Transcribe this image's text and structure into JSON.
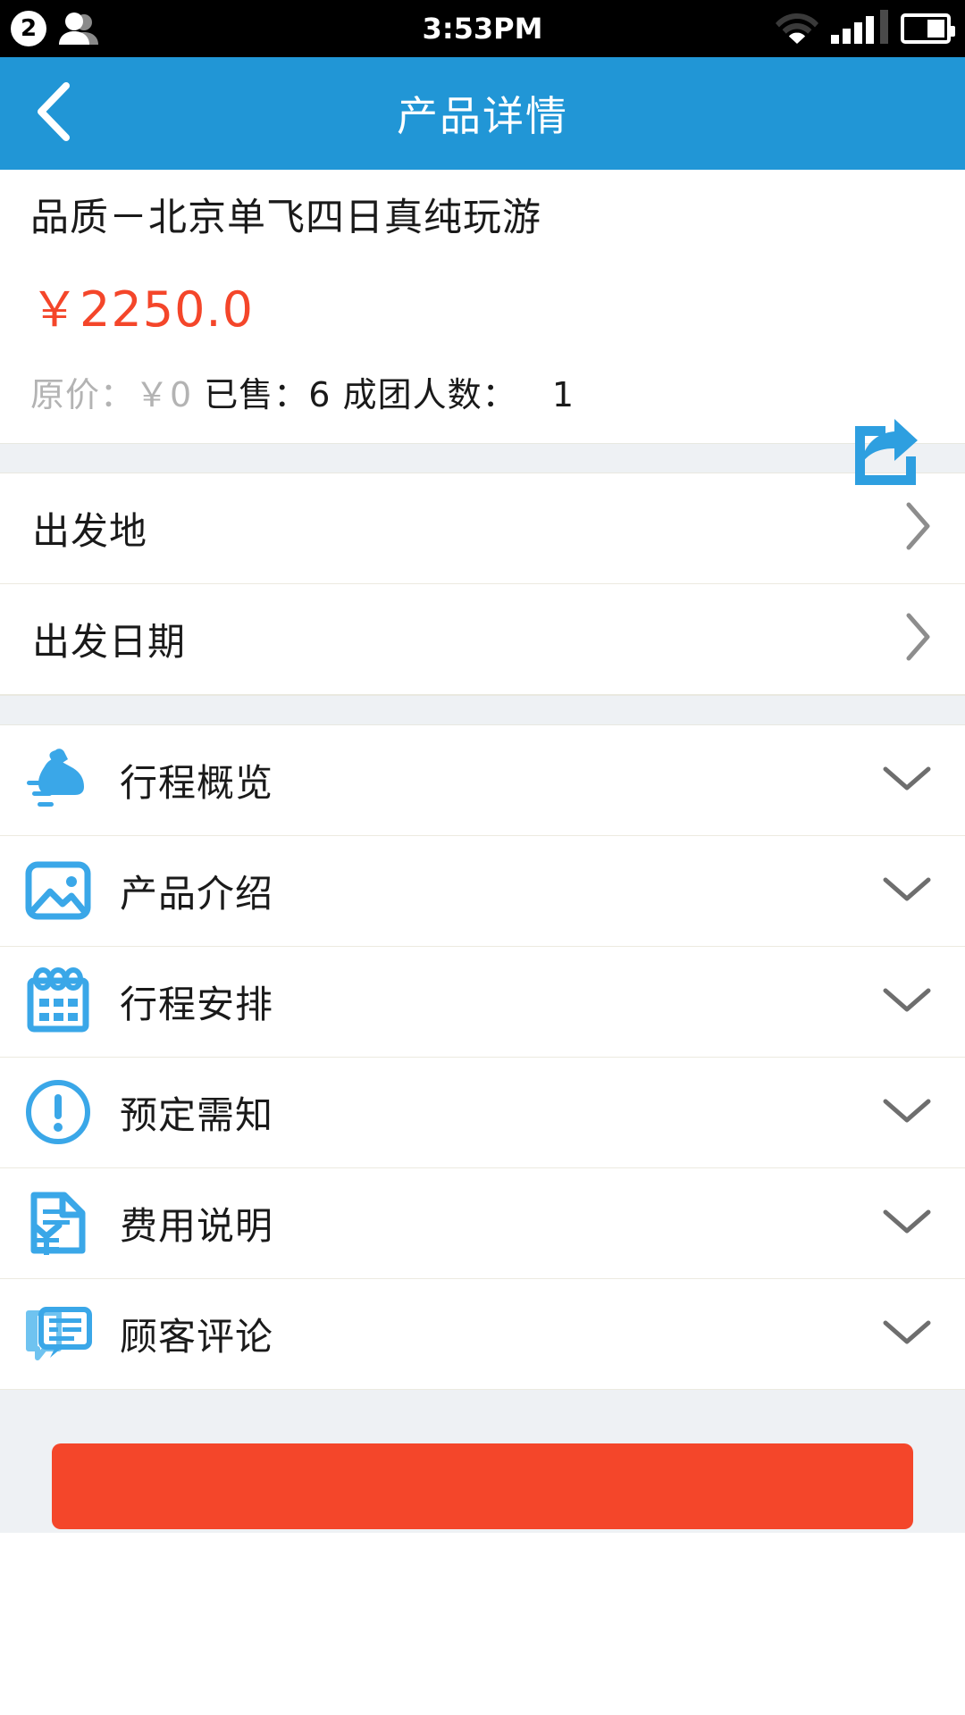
{
  "statusbar": {
    "notification_count": "2",
    "time": "3:53PM",
    "icons": [
      "contacts-icon",
      "wifi-icon",
      "signal-icon",
      "battery-icon"
    ]
  },
  "navbar": {
    "back_icon": "chevron-left-icon",
    "title": "产品详情"
  },
  "product": {
    "title": "品质－北京单飞四日真纯玩游",
    "price": "￥2250.0",
    "share_icon": "share-icon",
    "original_price_label": "原价：￥0",
    "sold_label": "已售：6",
    "group_size_label": "成团人数：",
    "group_size_value": "1"
  },
  "select_rows": [
    {
      "label": "出发地",
      "icon": "chevron-right-icon"
    },
    {
      "label": "出发日期",
      "icon": "chevron-right-icon"
    }
  ],
  "accordion_rows": [
    {
      "label": "行程概览",
      "icon": "shoe-icon",
      "chevron": "chevron-down-icon"
    },
    {
      "label": "产品介绍",
      "icon": "image-icon",
      "chevron": "chevron-down-icon"
    },
    {
      "label": "行程安排",
      "icon": "calendar-icon",
      "chevron": "chevron-down-icon"
    },
    {
      "label": "预定需知",
      "icon": "exclamation-circle-icon",
      "chevron": "chevron-down-icon"
    },
    {
      "label": "费用说明",
      "icon": "yen-document-icon",
      "chevron": "chevron-down-icon"
    },
    {
      "label": "顾客评论",
      "icon": "comments-icon",
      "chevron": "chevron-down-icon"
    }
  ],
  "footer": {
    "cta_label": ""
  },
  "colors": {
    "brand_blue": "#2196d6",
    "price_red": "#f4462a",
    "page_bg": "#eef1f4",
    "text_dark": "#1a1a1a",
    "text_muted": "#b3b3b3"
  }
}
